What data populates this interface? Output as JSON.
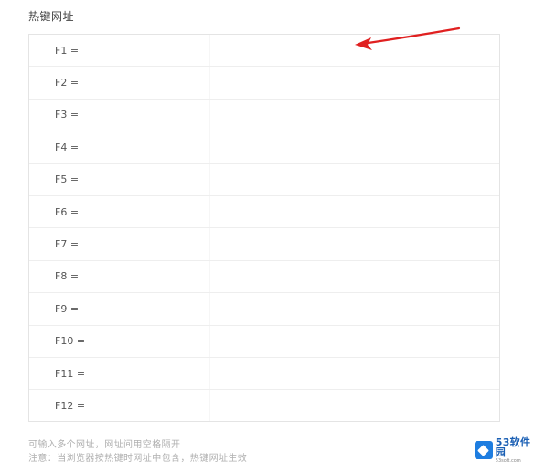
{
  "section": {
    "title": "热键网址"
  },
  "hotkeys": [
    {
      "key": "F1 =",
      "url": ""
    },
    {
      "key": "F2 =",
      "url": ""
    },
    {
      "key": "F3 =",
      "url": ""
    },
    {
      "key": "F4 =",
      "url": ""
    },
    {
      "key": "F5 =",
      "url": ""
    },
    {
      "key": "F6 =",
      "url": ""
    },
    {
      "key": "F7 =",
      "url": ""
    },
    {
      "key": "F8 =",
      "url": ""
    },
    {
      "key": "F9 =",
      "url": ""
    },
    {
      "key": "F10 =",
      "url": ""
    },
    {
      "key": "F11 =",
      "url": ""
    },
    {
      "key": "F12 =",
      "url": ""
    }
  ],
  "hints": [
    "可输入多个网址，网址间用空格隔开",
    "注意：当浏览器按热键时网址中包含，热键网址生效"
  ],
  "watermark": {
    "name": "53软件园",
    "url": "53soft.com",
    "color": "#1e7de0"
  },
  "annotation": {
    "arrow_color": "#e02020"
  }
}
